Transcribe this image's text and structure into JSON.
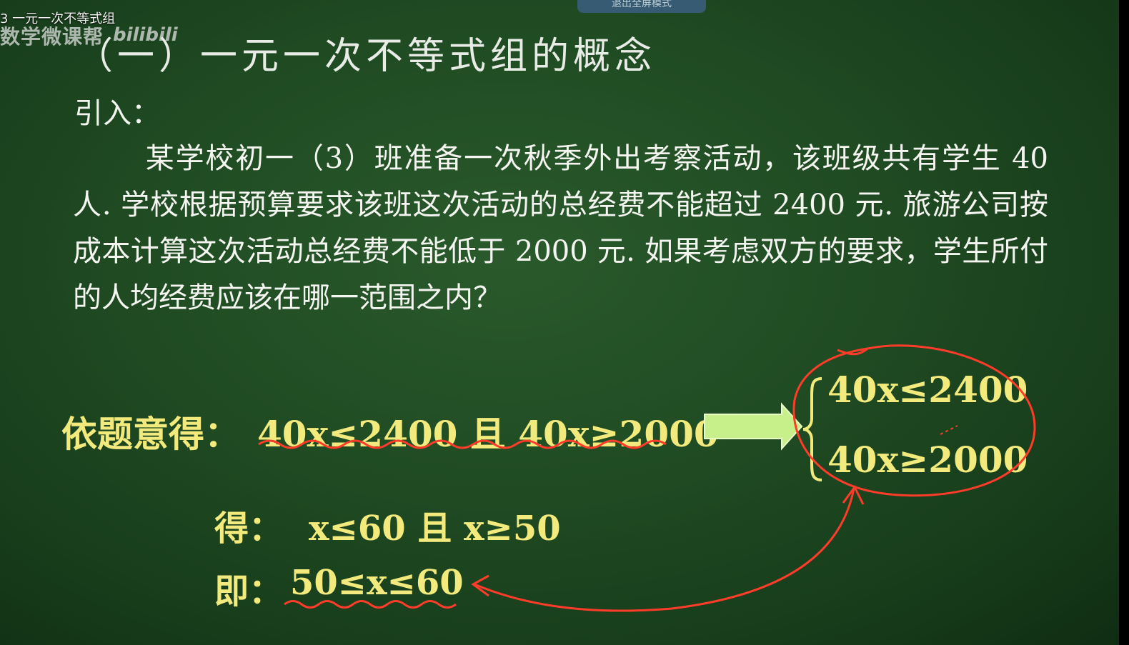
{
  "player": {
    "video_title": "3 一元一次不等式组",
    "top_tab": "退出全屏模式",
    "watermark": "数学微课帮",
    "logo_text": "bilibili"
  },
  "slide": {
    "heading": "（一）一元一次不等式组的概念",
    "intro_label": "引入：",
    "problem": "某学校初一（3）班准备一次秋季外出考察活动，该班级共有学生 40 人. 学校根据预算要求该班这次活动的总经费不能超过 2400 元. 旅游公司按成本计算这次活动总经费不能低于 2000 元. 如果考虑双方的要求，学生所付的人均经费应该在哪一范围之内？",
    "step1_label": "依题意得：",
    "step1_expr": "40x≤2400 且 40x≥2000",
    "system_line1": "40x≤2400",
    "system_line2": "40x≥2000",
    "step2_label": "得：",
    "step2_expr": "x≤60 且 x≥50",
    "step3_label": "即：",
    "step3_expr": "50≤x≤60"
  },
  "colors": {
    "board": "#1f4a22",
    "chalk_white": "#f4f4f0",
    "chalk_yellow": "#f2ea7c",
    "annotation_red": "#ff3b2a",
    "arrow_green": "#c8f08a"
  }
}
